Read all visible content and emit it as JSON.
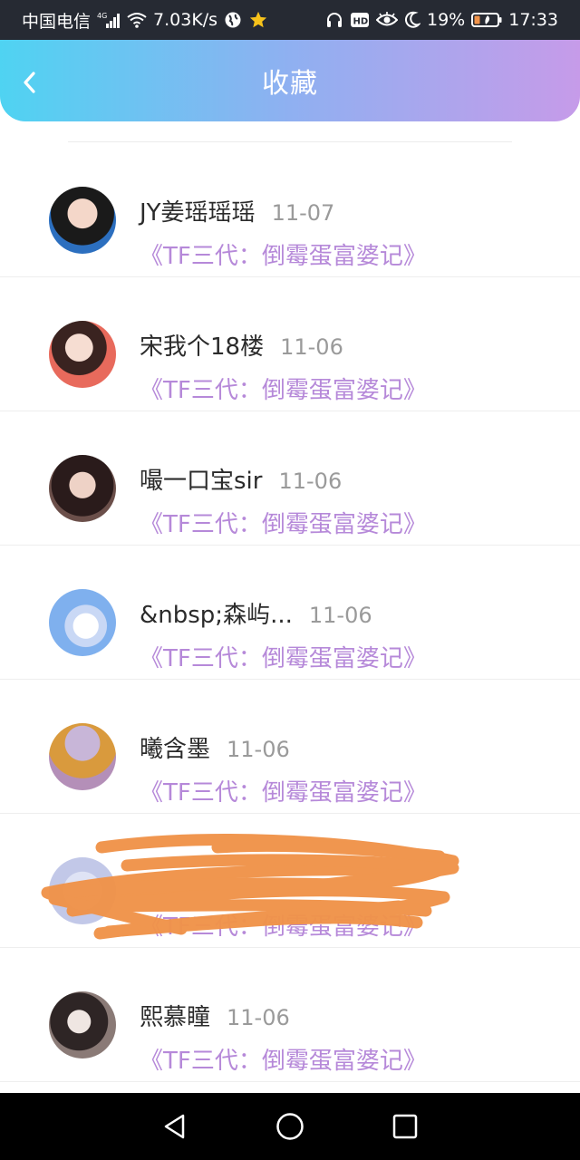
{
  "status_bar": {
    "carrier": "中国电信",
    "network": "4G",
    "speed": "7.03K/s",
    "battery": "19%",
    "time": "17:33",
    "icons": [
      "signal-icon",
      "wifi-icon",
      "globe-icon",
      "star-icon",
      "headphones-icon",
      "hd-icon",
      "eye-icon",
      "moon-icon",
      "battery-icon"
    ]
  },
  "header": {
    "title": "收藏",
    "back_icon": "chevron-left-icon"
  },
  "favorites": [
    {
      "name": "JY姜瑶瑶瑶",
      "date": "11-07",
      "work": "《TF三代：倒霉蛋富婆记》"
    },
    {
      "name": "宋我个18楼",
      "date": "11-06",
      "work": "《TF三代：倒霉蛋富婆记》"
    },
    {
      "name": "嘬一口宝sir",
      "date": "11-06",
      "work": "《TF三代：倒霉蛋富婆记》"
    },
    {
      "name": "&nbsp;森屿...",
      "date": "11-06",
      "work": "《TF三代：倒霉蛋富婆记》"
    },
    {
      "name": "曦含墨",
      "date": "11-06",
      "work": "《TF三代：倒霉蛋富婆记》"
    },
    {
      "name": "",
      "date": "",
      "work": "《TF三代：倒霉蛋富婆记》"
    },
    {
      "name": "熙慕瞳",
      "date": "11-06",
      "work": "《TF三代：倒霉蛋富婆记》"
    }
  ],
  "colors": {
    "header_gradient_start": "#4fd3f2",
    "header_gradient_end": "#c69be9",
    "work_title": "#b689d9",
    "scribble": "#f0934a"
  },
  "nav_bar": {
    "icons": [
      "back-triangle-icon",
      "home-circle-icon",
      "recents-square-icon"
    ]
  }
}
